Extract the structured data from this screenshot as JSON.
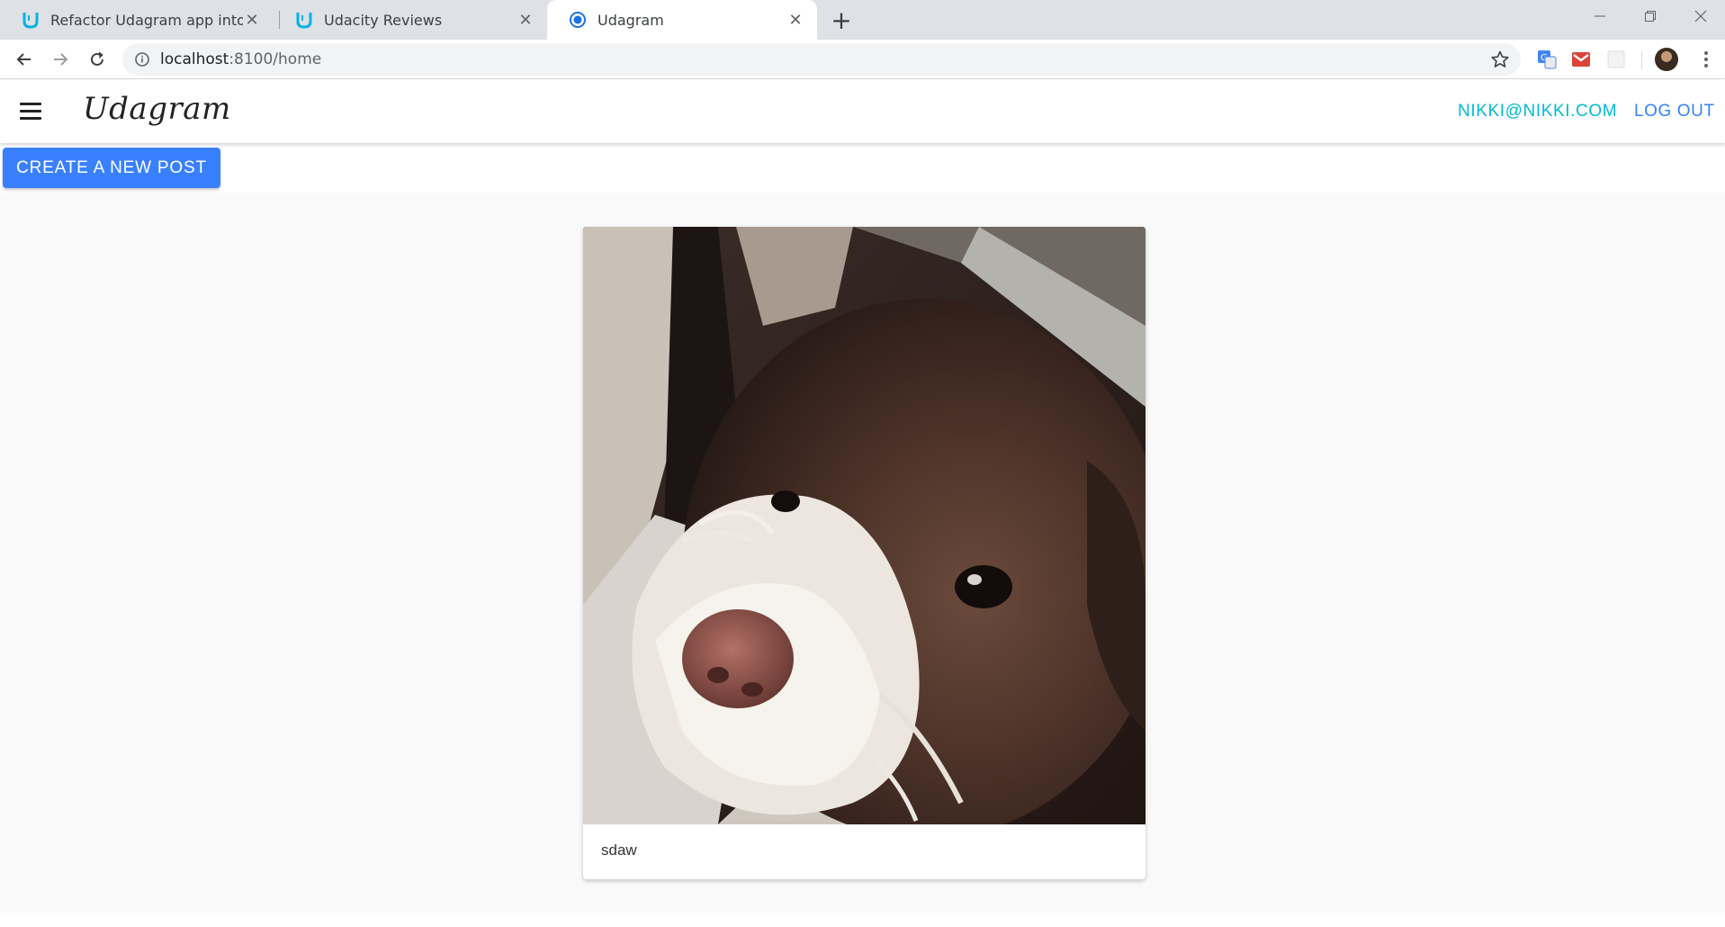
{
  "browser": {
    "tabs": [
      {
        "title": "Refactor Udagram app into Micr",
        "favicon": "udacity-logo-icon",
        "active": false
      },
      {
        "title": "Udacity Reviews",
        "favicon": "udacity-logo-icon",
        "active": false
      },
      {
        "title": "Udagram",
        "favicon": "globe-loading-icon",
        "active": true
      }
    ],
    "new_tab_label": "+",
    "address": {
      "host": "localhost",
      "rest": ":8100/home"
    }
  },
  "app": {
    "brand": "Udagram",
    "header": {
      "user_email": "NIKKI@NIKKI.COM",
      "logout_label": "LOG OUT"
    },
    "create_post_label": "CREATE A NEW POST",
    "colors": {
      "primary": "#3880ff",
      "secondary": "#00bcd4"
    },
    "feed": [
      {
        "image": "dog-photo",
        "caption": "sdaw"
      }
    ]
  }
}
